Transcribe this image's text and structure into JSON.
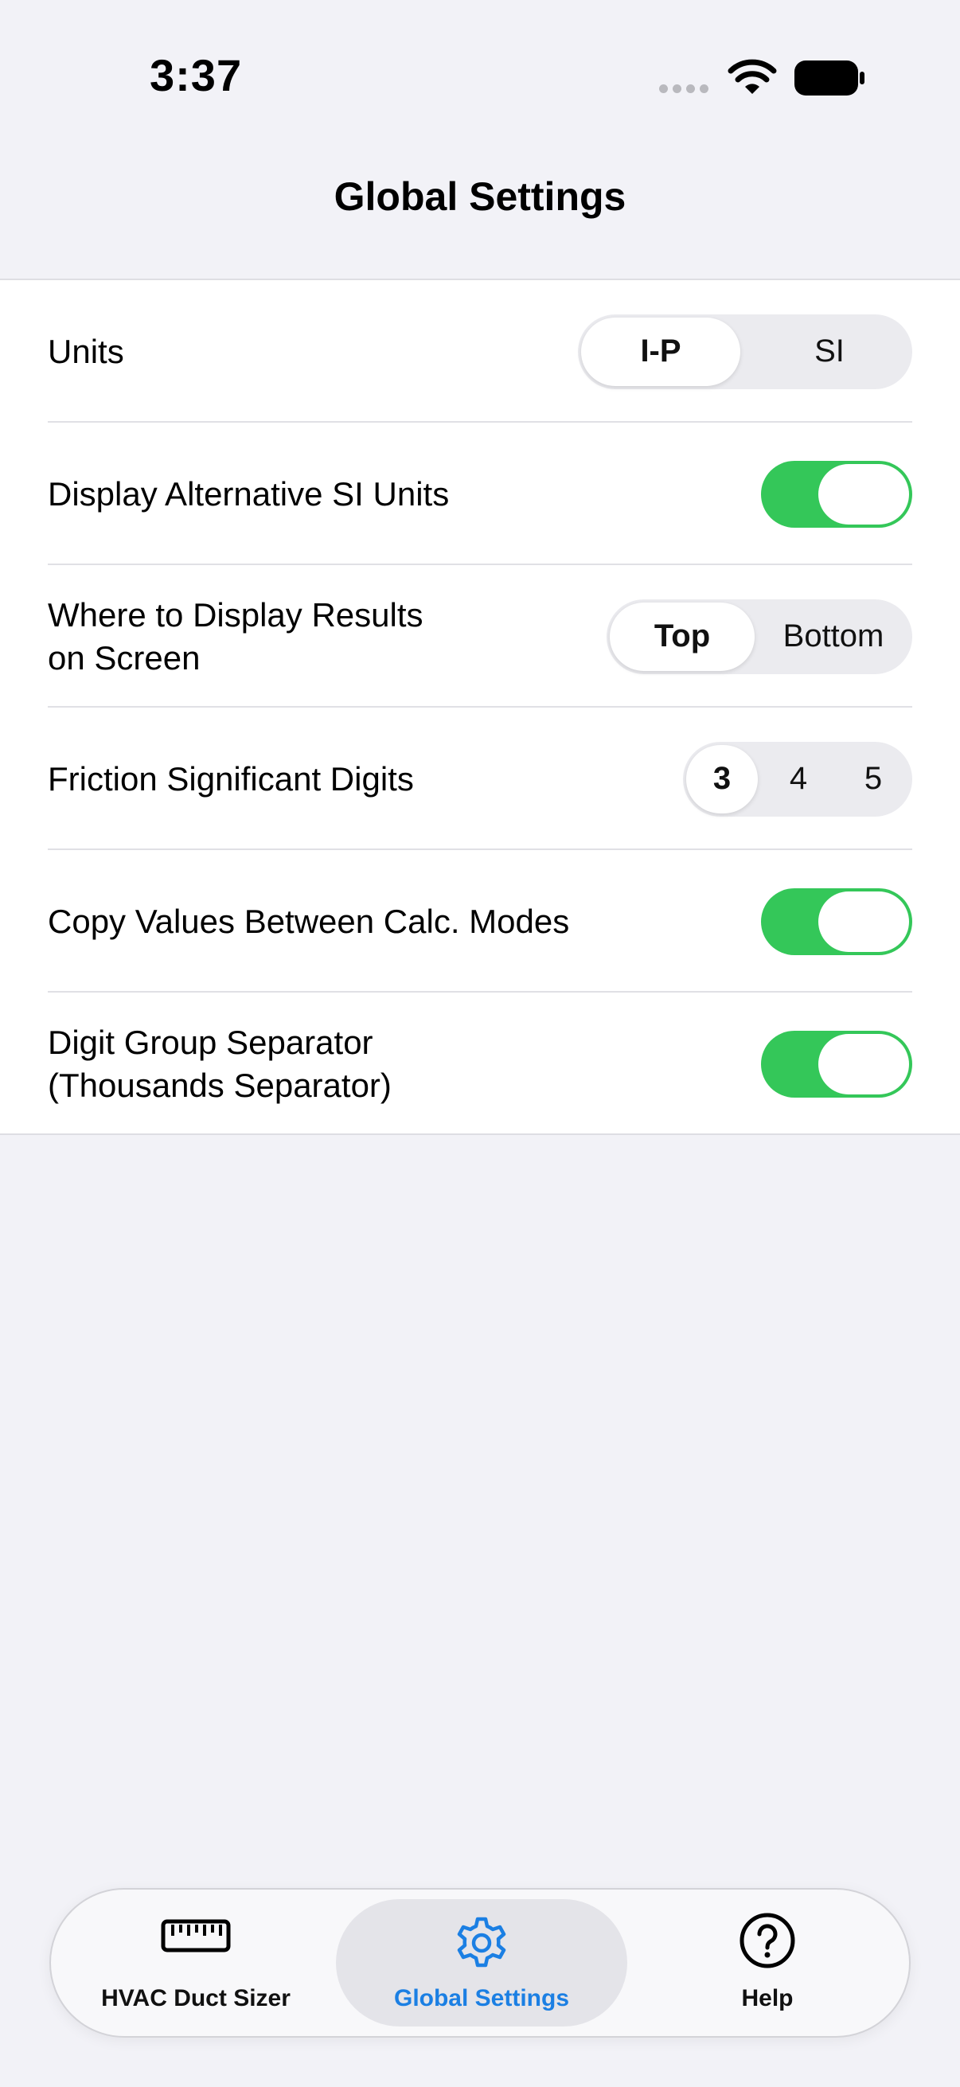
{
  "status_bar": {
    "time": "3:37"
  },
  "nav": {
    "title": "Global Settings"
  },
  "settings": {
    "units": {
      "label": "Units",
      "options": [
        "I-P",
        "SI"
      ],
      "selected": "I-P"
    },
    "alt_si": {
      "label": "Display Alternative SI Units",
      "on": true
    },
    "results_position": {
      "label": "Where to Display Results\non Screen",
      "options": [
        "Top",
        "Bottom"
      ],
      "selected": "Top"
    },
    "friction_digits": {
      "label": "Friction Significant Digits",
      "options": [
        "3",
        "4",
        "5"
      ],
      "selected": "3"
    },
    "copy_values": {
      "label": "Copy Values Between Calc. Modes",
      "on": true
    },
    "digit_separator": {
      "label": "Digit Group Separator\n(Thousands Separator)",
      "on": true
    }
  },
  "tab_bar": {
    "tabs": [
      {
        "label": "HVAC Duct Sizer",
        "icon": "ruler-icon",
        "active": false
      },
      {
        "label": "Global Settings",
        "icon": "gear-icon",
        "active": true
      },
      {
        "label": "Help",
        "icon": "question-circle-icon",
        "active": false
      }
    ]
  },
  "colors": {
    "toggle_on": "#34c759",
    "accent": "#1b7fe3",
    "background": "#f2f2f7"
  }
}
